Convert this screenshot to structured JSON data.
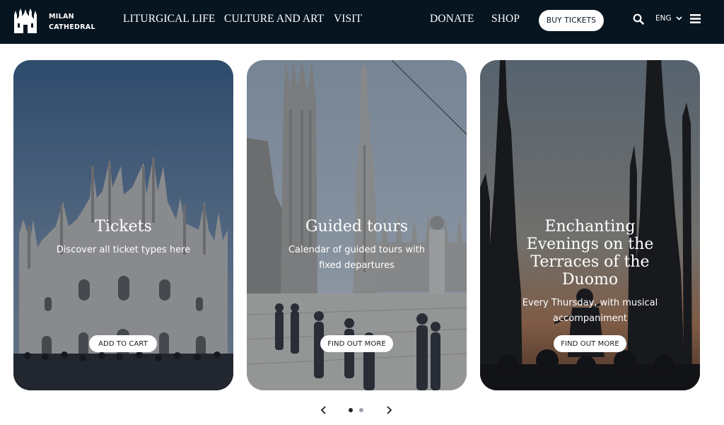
{
  "header": {
    "brand_line1": "MILAN",
    "brand_line2": "CATHEDRAL",
    "nav": [
      "LITURGICAL LIFE",
      "CULTURE AND ART",
      "VISIT",
      "DONATE",
      "SHOP"
    ],
    "buy_tickets": "BUY TICKETS",
    "language": "ENG",
    "icons": [
      "cathedral-logo-icon",
      "search-icon",
      "chevron-down-icon",
      "hamburger-menu-icon"
    ]
  },
  "cards": [
    {
      "title": "Tickets",
      "description": "Discover all ticket types here",
      "button": "ADD TO CART"
    },
    {
      "title": "Guided tours",
      "description": "Calendar of guided tours with fixed departures",
      "button": "FIND OUT MORE"
    },
    {
      "title": "Enchanting Evenings on the Terraces of the Duomo",
      "description": "Every Thursday, with musical accompaniment",
      "button": "FIND OUT MORE"
    }
  ],
  "carousel": {
    "active_dot": 1,
    "dot_count": 2,
    "controls": [
      "chevron-left-icon",
      "chevron-right-icon"
    ]
  },
  "colors": {
    "header_bg": "#071520",
    "white": "#ffffff",
    "dot_active": "#222222",
    "dot_inactive": "#9aa3ab"
  }
}
